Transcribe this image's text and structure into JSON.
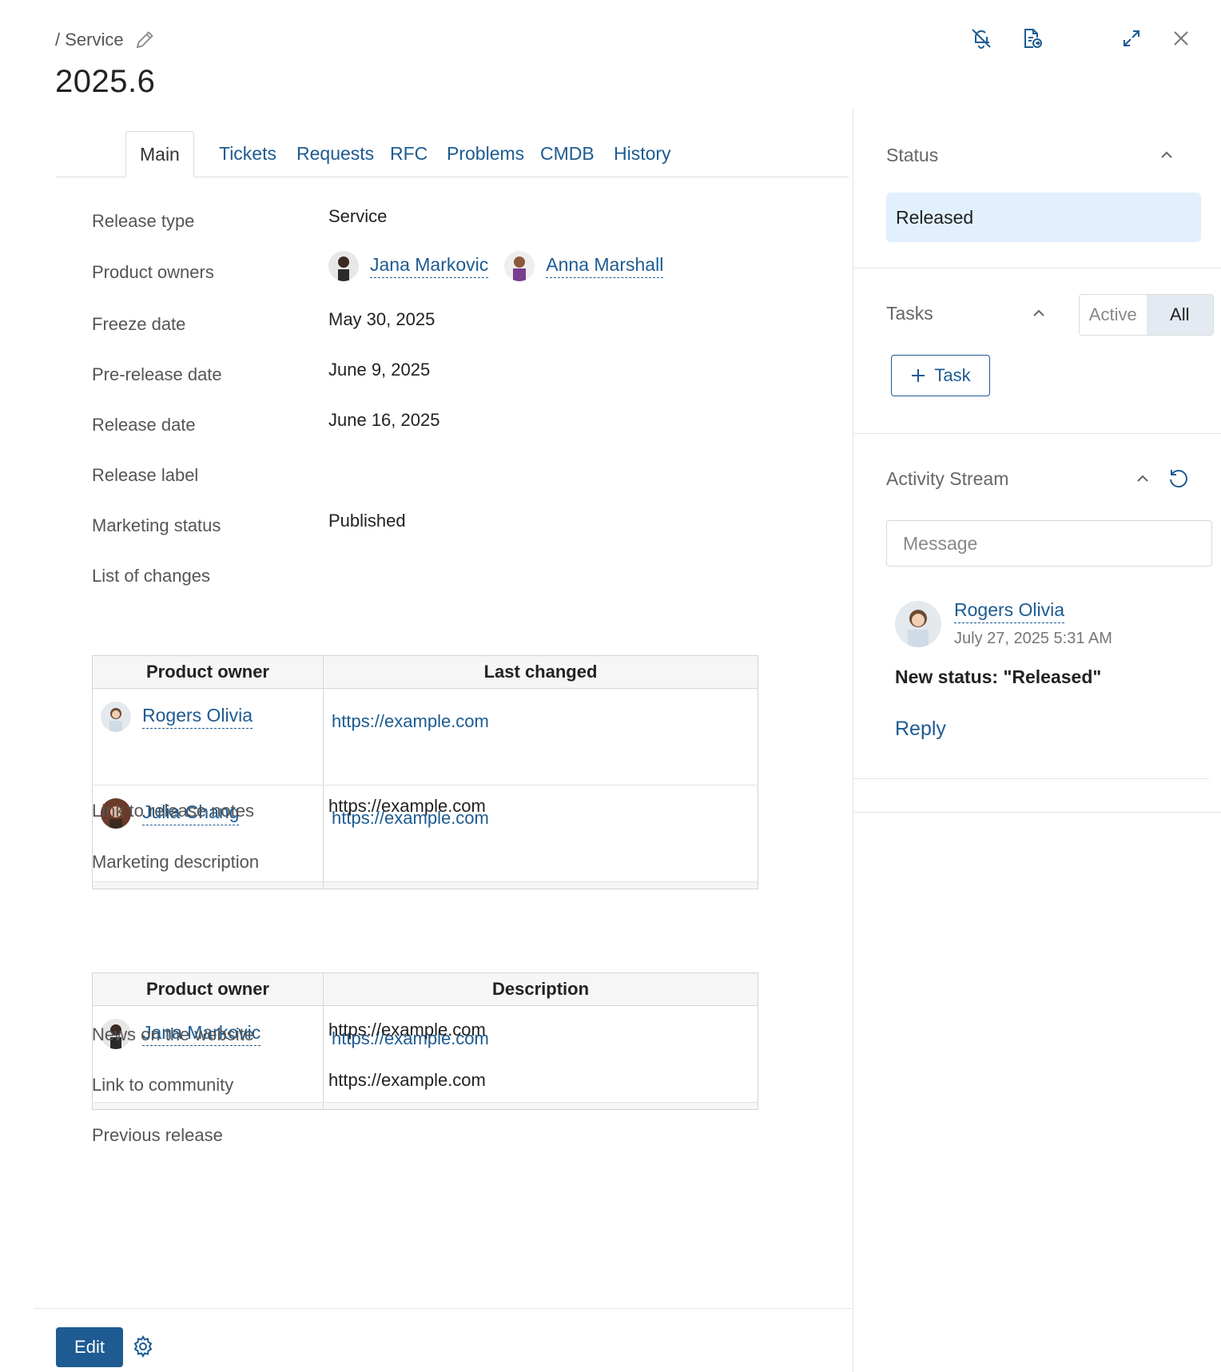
{
  "header": {
    "breadcrumb": "/ Service",
    "title": "2025.6"
  },
  "tabs": [
    "Main",
    "Tickets",
    "Requests",
    "RFC",
    "Problems",
    "CMDB",
    "History"
  ],
  "fields": {
    "release_type": {
      "label": "Release type",
      "value": "Service"
    },
    "product_owners": {
      "label": "Product owners",
      "owners": [
        "Jana Markovic",
        "Anna Marshall"
      ]
    },
    "freeze_date": {
      "label": "Freeze date",
      "value": "May 30, 2025"
    },
    "prerelease_date": {
      "label": "Pre-release date",
      "value": "June 9, 2025"
    },
    "release_date": {
      "label": "Release date",
      "value": "June 16, 2025"
    },
    "release_label": {
      "label": "Release label",
      "value": ""
    },
    "marketing_status": {
      "label": "Marketing status",
      "value": "Published"
    },
    "list_of_changes": {
      "label": "List of changes"
    },
    "release_notes": {
      "label": "Link to release notes",
      "value": "https://example.com"
    },
    "marketing_description": {
      "label": "Marketing description"
    },
    "news": {
      "label": "News on the website",
      "value": "https://example.com"
    },
    "community": {
      "label": "Link to community",
      "value": "https://example.com"
    },
    "previous_release": {
      "label": "Previous release",
      "value": ""
    }
  },
  "changes_table": {
    "columns": [
      "Product owner",
      "Last changed"
    ],
    "rows": [
      {
        "owner": "Rogers Olivia",
        "link": "https://example.com"
      },
      {
        "owner": "Julia Chang",
        "link": "https://example.com"
      }
    ]
  },
  "description_table": {
    "columns": [
      "Product owner",
      "Description"
    ],
    "rows": [
      {
        "owner": "Jana Markovic",
        "link": "https://example.com"
      }
    ]
  },
  "footer": {
    "edit_label": "Edit"
  },
  "sidebar": {
    "status": {
      "title": "Status",
      "value": "Released"
    },
    "tasks": {
      "title": "Tasks",
      "toggle": [
        "Active",
        "All"
      ],
      "selected": "All",
      "add_label": "Task"
    },
    "activity": {
      "title": "Activity Stream",
      "message_placeholder": "Message",
      "post": {
        "author": "Rogers Olivia",
        "time": "July 27, 2025 5:31 AM",
        "text": "New status: \"Released\"",
        "reply_label": "Reply"
      }
    }
  },
  "colors": {
    "accent": "#1d5b92",
    "status_bg": "#e2f0fd",
    "toggle_on": "#e3eaf1"
  }
}
